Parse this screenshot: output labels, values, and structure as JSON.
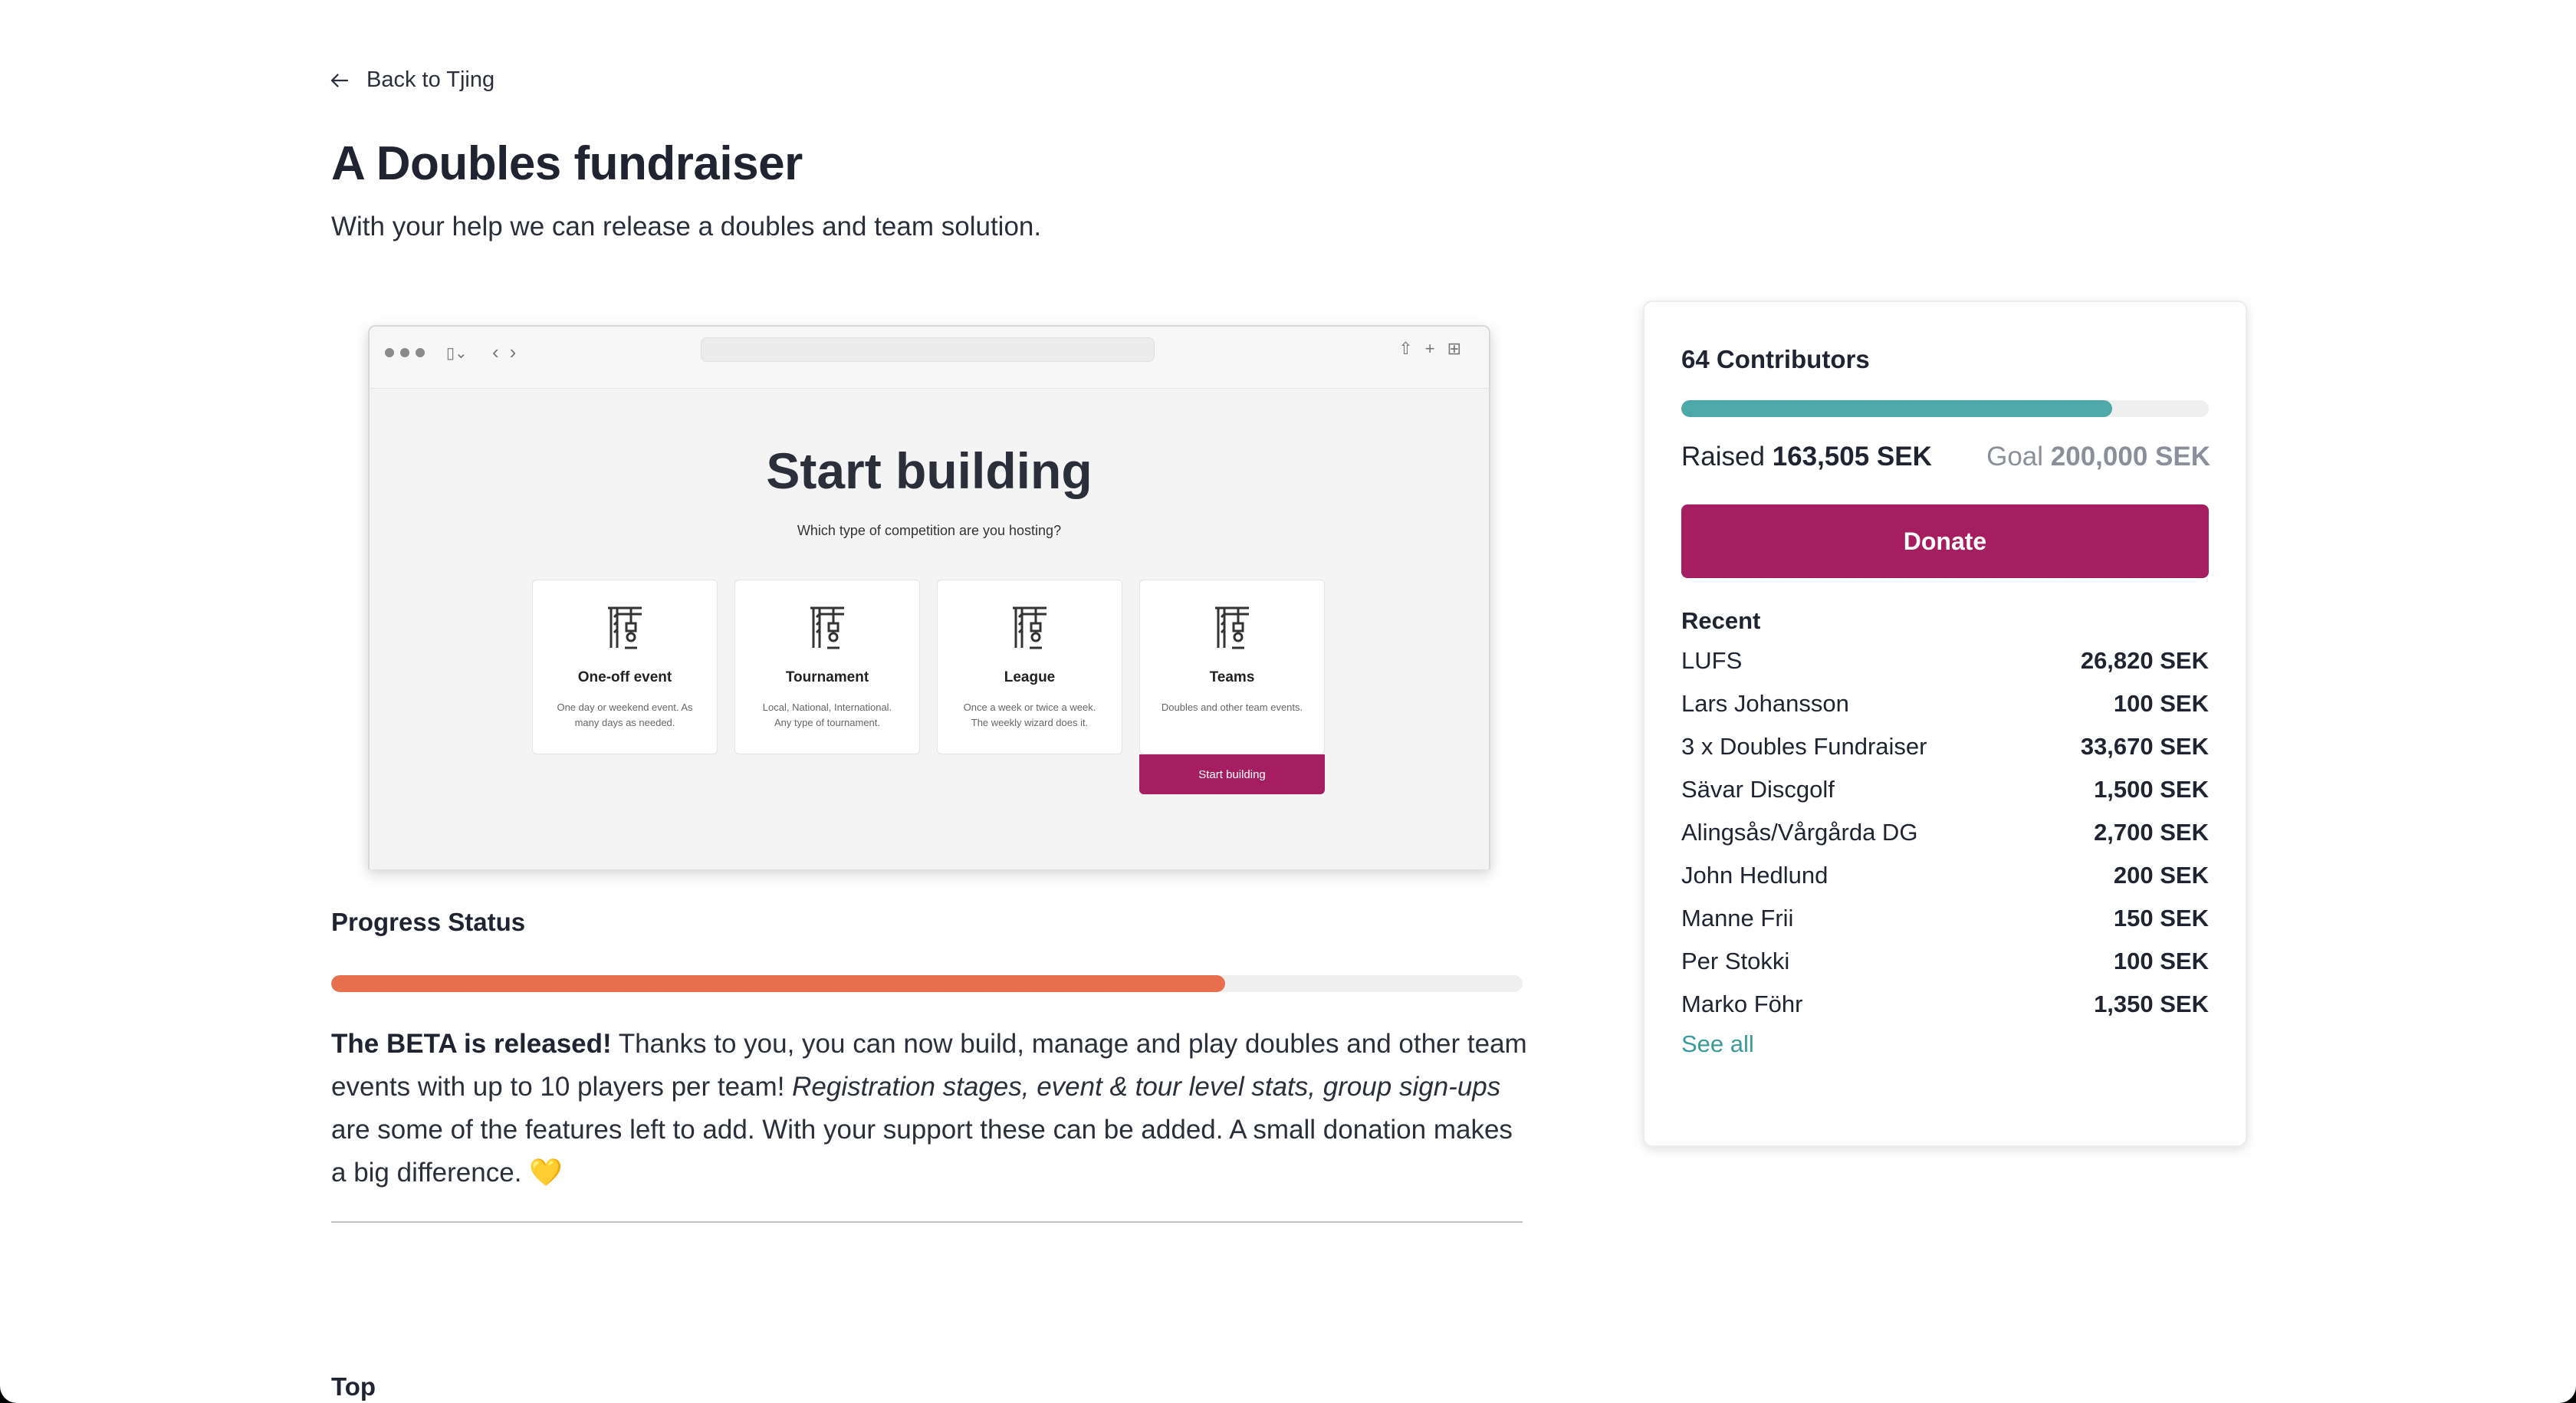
{
  "nav": {
    "back_label": "Back to Tjing"
  },
  "header": {
    "title": "A Doubles fundraiser",
    "subtitle": "With your help we can release a doubles and team solution."
  },
  "preview": {
    "heading": "Start building",
    "question": "Which type of competition are you hosting?",
    "cards": [
      {
        "title": "One-off event",
        "desc": "One day or weekend event. As many days as needed."
      },
      {
        "title": "Tournament",
        "desc": "Local, National, International. Any type of tournament."
      },
      {
        "title": "League",
        "desc": "Once a week or twice a week. The weekly wizard does it."
      },
      {
        "title": "Teams",
        "desc": "Doubles and other team events."
      }
    ],
    "start_button": "Start building"
  },
  "progress": {
    "label": "Progress Status",
    "fraction": 0.75,
    "color": "#e86f4e"
  },
  "description": {
    "lead": "The BETA is released!",
    "text1": " Thanks to you, you can now build, manage and play doubles and other team events with up to 10 players per team! ",
    "italic": "Registration stages, event & tour level stats, group sign-ups",
    "text2": " are some of the features left to add. With your support these can be added. A small donation makes a big difference. ",
    "emoji": "💛"
  },
  "bottom": {
    "heading": "Top"
  },
  "fund": {
    "contributors": "64 Contributors",
    "fraction": 0.8175,
    "bar_color": "#4da8a8",
    "raised_label": "Raised",
    "raised_value": "163,505 SEK",
    "goal_label": "Goal",
    "goal_value": "200,000 SEK",
    "donate_label": "Donate",
    "accent": "#a51f60",
    "recent_label": "Recent",
    "recent": [
      {
        "name": "LUFS",
        "amount": "26,820 SEK"
      },
      {
        "name": "Lars Johansson",
        "amount": "100 SEK"
      },
      {
        "name": "3 x Doubles Fundraiser",
        "amount": "33,670 SEK"
      },
      {
        "name": "Sävar Discgolf",
        "amount": "1,500 SEK"
      },
      {
        "name": "Alingsås/Vårgårda DG",
        "amount": "2,700 SEK"
      },
      {
        "name": "John Hedlund",
        "amount": "200 SEK"
      },
      {
        "name": "Manne Frii",
        "amount": "150 SEK"
      },
      {
        "name": "Per Stokki",
        "amount": "100 SEK"
      },
      {
        "name": "Marko Föhr",
        "amount": "1,350 SEK"
      }
    ],
    "see_all": "See all"
  }
}
